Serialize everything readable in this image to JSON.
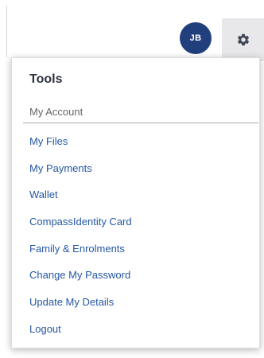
{
  "header": {
    "avatar_initials": "JB",
    "avatar_color": "#213f7c",
    "settings_icon": "gear-icon"
  },
  "dropdown": {
    "title": "Tools",
    "section_label": "My Account",
    "link_color": "#2457a3",
    "items": [
      {
        "label": "My Files"
      },
      {
        "label": "My Payments"
      },
      {
        "label": "Wallet"
      },
      {
        "label": "CompassIdentity Card"
      },
      {
        "label": "Family & Enrolments"
      },
      {
        "label": "Change My Password"
      },
      {
        "label": "Update My Details"
      },
      {
        "label": "Logout"
      }
    ]
  }
}
